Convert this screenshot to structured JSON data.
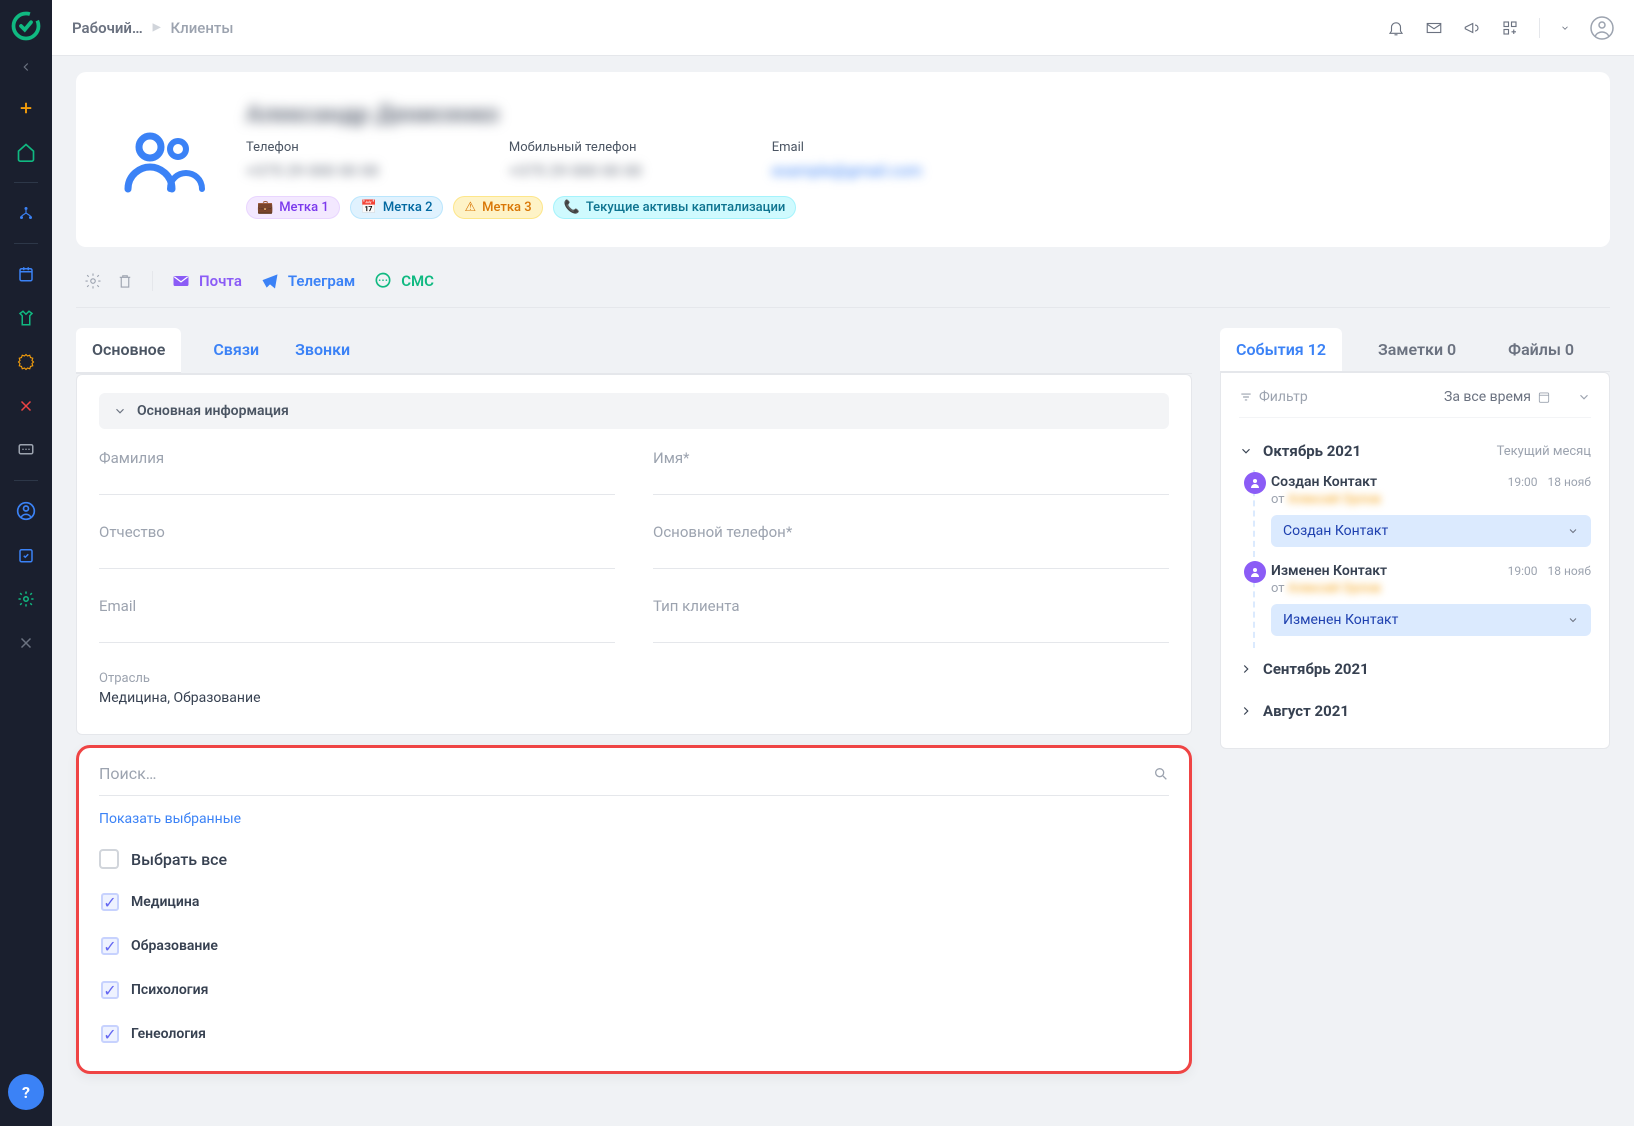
{
  "breadcrumb": {
    "root": "Рабочий…",
    "current": "Клиенты"
  },
  "sidebar": {
    "help": "?"
  },
  "client": {
    "name": "Александр Денисенко",
    "phone_label": "Телефон",
    "phone_value": "+375 29 000 00 00",
    "mobile_label": "Мобильный телефон",
    "mobile_value": "+375 29 000 00 00",
    "email_label": "Email",
    "email_value": "example@gmail.com",
    "tags": {
      "t1": "Метка 1",
      "t2": "Метка 2",
      "t3": "Метка 3",
      "t4": "Текущие активы капитализации"
    }
  },
  "actions": {
    "mail": "Почта",
    "telegram": "Телеграм",
    "sms": "СМС"
  },
  "main_tabs": {
    "main": "Основное",
    "links": "Связи",
    "calls": "Звонки"
  },
  "form": {
    "section": "Основная информация",
    "lastname": "Фамилия",
    "firstname": "Имя*",
    "patronymic": "Отчество",
    "mainphone": "Основной телефон*",
    "email": "Email",
    "clienttype": "Тип клиента",
    "industry_label": "Отрасль",
    "industry_value": "Медицина, Образование"
  },
  "dropdown": {
    "search_placeholder": "Поиск…",
    "show_selected": "Показать выбранные",
    "select_all": "Выбрать все",
    "items": [
      "Медицина",
      "Образование",
      "Психология",
      "Генеология"
    ]
  },
  "right_tabs": {
    "events": "События 12",
    "notes": "Заметки 0",
    "files": "Файлы 0"
  },
  "filter": {
    "label": "Фильтр",
    "period": "За все время"
  },
  "timeline": {
    "current_month": "Октябрь 2021",
    "current_sub": "Текущий месяц",
    "events": [
      {
        "title": "Создан Контакт",
        "time": "19:00",
        "date": "18 нояб",
        "from": "от",
        "author": "Алексей Орлов",
        "pill": "Создан Контакт"
      },
      {
        "title": "Изменен Контакт",
        "time": "19:00",
        "date": "18 нояб",
        "from": "от",
        "author": "Алексей Орлов",
        "pill": "Изменен Контакт"
      }
    ],
    "m2": "Сентябрь 2021",
    "m3": "Август 2021"
  }
}
